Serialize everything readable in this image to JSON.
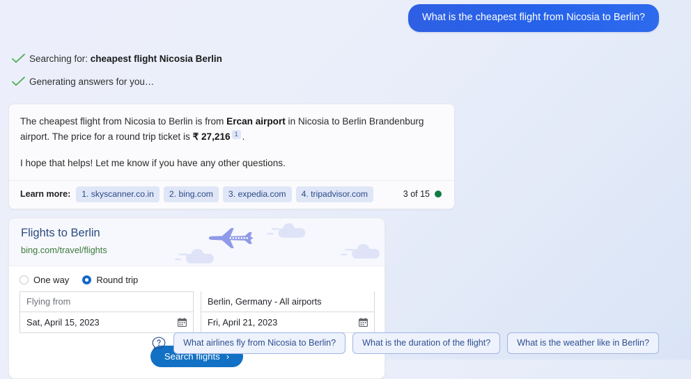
{
  "user_message": {
    "text": "What is the cheapest flight from Nicosia to Berlin?"
  },
  "status": {
    "items": [
      {
        "prefix": "Searching for: ",
        "query": "cheapest flight Nicosia Berlin"
      },
      {
        "prefix": "Generating answers for you…",
        "query": ""
      }
    ]
  },
  "answer": {
    "para1_a": "The cheapest flight from Nicosia to Berlin is from ",
    "para1_bold": "Ercan airport",
    "para1_b": " in Nicosia to Berlin Brandenburg airport. The price for a round trip ticket is ",
    "price": "₹ 27,216",
    "citation_marker": "1",
    "para1_c": ".",
    "para2": "I hope that helps! Let me know if you have any other questions.",
    "learn_more_label": "Learn more:",
    "citations": [
      "1. skyscanner.co.in",
      "2. bing.com",
      "3. expedia.com",
      "4. tripadvisor.com"
    ],
    "counter": "3 of 15",
    "counter_dot_color": "#107c41"
  },
  "flight_widget": {
    "title": "Flights to Berlin",
    "url": "bing.com/travel/flights",
    "trip_type": {
      "one_way_label": "One way",
      "round_trip_label": "Round trip",
      "selected": "round_trip"
    },
    "origin": {
      "placeholder": "Flying from",
      "value": ""
    },
    "destination": {
      "value": "Berlin,  Germany - All airports"
    },
    "depart_date": {
      "value": "Sat, April 15, 2023"
    },
    "return_date": {
      "value": "Fri, April 21, 2023"
    },
    "search_button": {
      "label": "Search flights",
      "chevron": "›"
    },
    "accent_color": "#1271c4",
    "plane_color": "#8f9ae8",
    "cloud_color": "#dfe3f7"
  },
  "suggestions": {
    "help_icon": "question-bubble-icon",
    "chips": [
      "What airlines fly from Nicosia to Berlin?",
      "What is the duration of the flight?",
      "What is the weather like in Berlin?"
    ]
  }
}
